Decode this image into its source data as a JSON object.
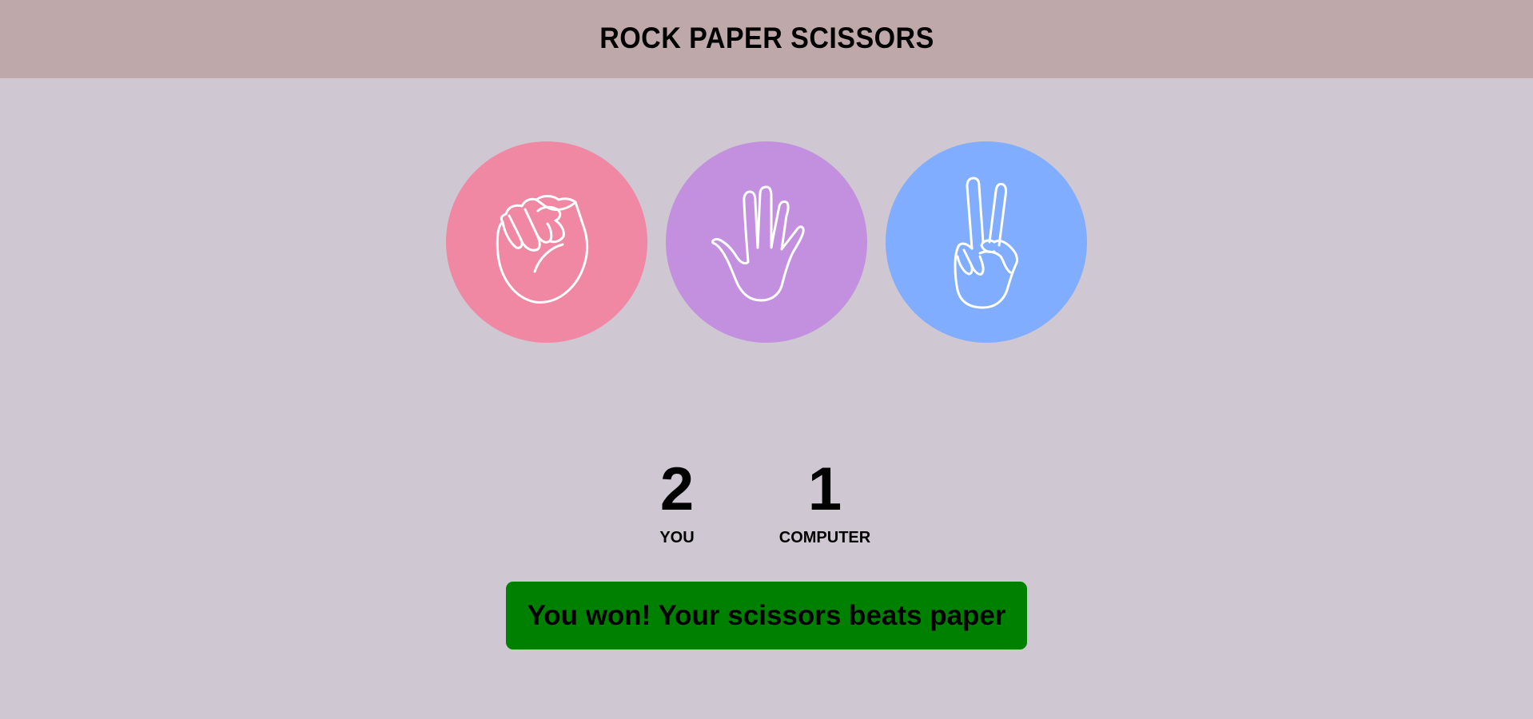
{
  "header": {
    "title": "ROCK PAPER SCISSORS",
    "background": "#bfa8a9"
  },
  "page": {
    "background": "#cfc7d2"
  },
  "choices": [
    {
      "name": "rock",
      "icon": "fist-icon",
      "color": "#f087a3"
    },
    {
      "name": "paper",
      "icon": "open-hand-icon",
      "color": "#c290de"
    },
    {
      "name": "scissors",
      "icon": "peace-sign-hand-icon",
      "color": "#80adff"
    }
  ],
  "scoreboard": {
    "you": {
      "score": "2",
      "label": "YOU"
    },
    "computer": {
      "score": "1",
      "label": "COMPUTER"
    }
  },
  "result": {
    "message": "You won! Your scissors beats paper",
    "color": "#008000"
  }
}
